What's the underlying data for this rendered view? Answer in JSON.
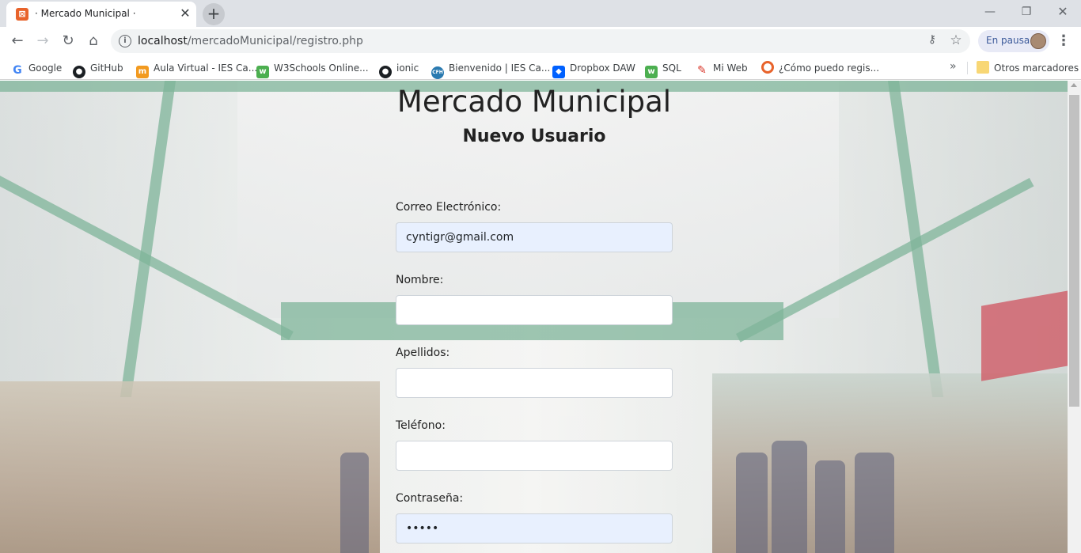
{
  "browser": {
    "tab_title": "· Mercado Municipal ·",
    "tab_close_icon": "close-icon",
    "new_tab_icon": "plus-icon",
    "url_host": "localhost",
    "url_path": "/mercadoMunicipal/registro.php",
    "profile_label": "En pausa",
    "bookmarks": [
      {
        "label": "Google",
        "icon": "google-icon"
      },
      {
        "label": "GitHub",
        "icon": "github-icon"
      },
      {
        "label": "Aula Virtual - IES Ca...",
        "icon": "aula-virtual-icon"
      },
      {
        "label": "W3Schools Online...",
        "icon": "w3schools-icon"
      },
      {
        "label": "ionic",
        "icon": "github-icon"
      },
      {
        "label": "Bienvenido | IES Ca...",
        "icon": "ies-icon"
      },
      {
        "label": "Dropbox DAW",
        "icon": "dropbox-icon"
      },
      {
        "label": "SQL",
        "icon": "w3schools-icon"
      },
      {
        "label": "Mi Web",
        "icon": "mi-web-icon"
      },
      {
        "label": "¿Cómo puedo regis...",
        "icon": "circle-icon"
      }
    ],
    "more_bookmarks": "»",
    "other_bookmarks": "Otros marcadores"
  },
  "page": {
    "title": "Mercado Municipal",
    "subtitle": "Nuevo Usuario",
    "fields": {
      "email": {
        "label": "Correo Electrónico:",
        "value": "cyntigr@gmail.com"
      },
      "nombre": {
        "label": "Nombre:",
        "value": ""
      },
      "apellidos": {
        "label": "Apellidos:",
        "value": ""
      },
      "telefono": {
        "label": "Teléfono:",
        "value": ""
      },
      "password": {
        "label": "Contraseña:",
        "value": "•••••"
      }
    }
  }
}
